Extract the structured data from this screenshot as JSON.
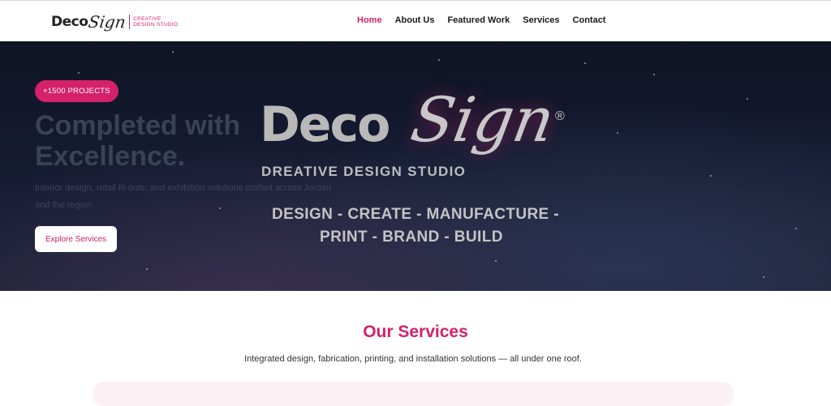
{
  "header": {
    "logo": {
      "deco": "Deco",
      "sign": "Sign",
      "tag_line1": "CREATIVE",
      "tag_line2": "DESIGN STUDIO"
    },
    "nav": [
      {
        "label": "Home",
        "active": true
      },
      {
        "label": "About Us",
        "active": false
      },
      {
        "label": "Featured Work",
        "active": false
      },
      {
        "label": "Services",
        "active": false
      },
      {
        "label": "Contact",
        "active": false
      }
    ]
  },
  "hero": {
    "badge": "+1500 PROJECTS",
    "title_line1": "Completed with",
    "title_line2": "Excellence.",
    "description": "Interior design, retail fit-outs, and exhibition solutions crafted across Jordan and the region.",
    "cta_label": "Explore Services",
    "brand": {
      "deco": "Deco",
      "sign": "Sign",
      "registered": "®",
      "studio": "DREATIVE DESIGN STUDIO",
      "line1": "DESIGN - CREATE - MANUFACTURE -",
      "line2": "PRINT - BRAND - BUILD"
    }
  },
  "services": {
    "title": "Our Services",
    "description": "Integrated design, fabrication, printing, and installation solutions — all under one roof."
  },
  "colors": {
    "accent": "#d4216a",
    "hero_bg": "#161c33",
    "text_dark": "#1a1a1a"
  }
}
